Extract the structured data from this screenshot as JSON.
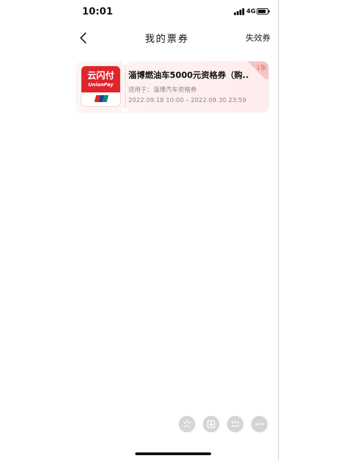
{
  "status_bar": {
    "time": "10:01",
    "network": "4G"
  },
  "nav": {
    "title": "我的票券",
    "right_link": "失效券"
  },
  "tickets": [
    {
      "title": "淄博燃油车5000元资格券（购...",
      "scope": "适用于：淄博汽车资格券",
      "period": "2022.09.18 10:00 – 2022.09.30 23:59",
      "count_badge": "1张",
      "logo": {
        "cn_text": "云闪付",
        "en_text": "UnionPay",
        "brand_color": "#e0242c"
      }
    }
  ],
  "floating_actions": [
    {
      "icon": "loading-icon"
    },
    {
      "icon": "download-icon"
    },
    {
      "icon": "grid-icon"
    },
    {
      "icon": "more-icon"
    }
  ]
}
